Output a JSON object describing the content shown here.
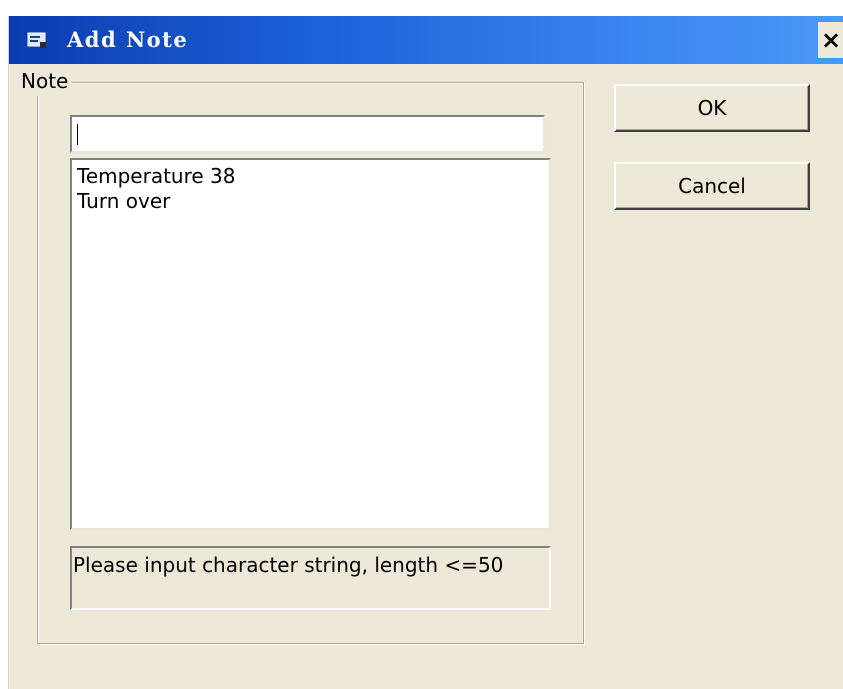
{
  "window": {
    "title": "Add Note",
    "close_glyph": "×",
    "icon": "note-app-icon",
    "titlebar_color_start": "#0a3dae",
    "titlebar_color_end": "#4a98f8",
    "background_color": "#ece9d8"
  },
  "note_group": {
    "legend": "Note",
    "input_value": "",
    "items": [
      "Temperature 38",
      "Turn over"
    ],
    "hint": "Please input character string, length <=50"
  },
  "buttons": {
    "ok_label": "OK",
    "cancel_label": "Cancel"
  }
}
